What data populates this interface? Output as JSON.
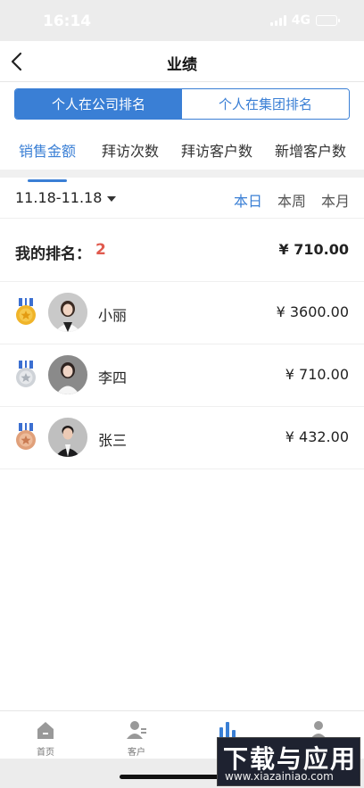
{
  "status_bar": {
    "time": "16:14",
    "network": "4G"
  },
  "nav": {
    "title": "业绩"
  },
  "scope_tabs": [
    {
      "label": "个人在公司排名",
      "active": true
    },
    {
      "label": "个人在集团排名",
      "active": false
    }
  ],
  "metric_tabs": [
    {
      "label": "销售金额",
      "active": true
    },
    {
      "label": "拜访次数",
      "active": false
    },
    {
      "label": "拜访客户数",
      "active": false
    },
    {
      "label": "新增客户数",
      "active": false
    }
  ],
  "date_filter": {
    "range": "11.18-11.18"
  },
  "periods": [
    {
      "label": "本日",
      "active": true
    },
    {
      "label": "本周",
      "active": false
    },
    {
      "label": "本月",
      "active": false
    }
  ],
  "my_rank": {
    "label": "我的排名：",
    "value": "2",
    "amount": "¥ 710.00"
  },
  "ranking": [
    {
      "rank": 1,
      "medal": "gold-medal-icon",
      "name": "小丽",
      "amount": "¥ 3600.00"
    },
    {
      "rank": 2,
      "medal": "silver-medal-icon",
      "name": "李四",
      "amount": "¥ 710.00"
    },
    {
      "rank": 3,
      "medal": "bronze-medal-icon",
      "name": "张三",
      "amount": "¥ 432.00"
    }
  ],
  "tab_bar": [
    {
      "label": "首页",
      "icon": "home-icon"
    },
    {
      "label": "客户",
      "icon": "customer-icon"
    },
    {
      "label": "",
      "icon": "bar-chart-icon"
    },
    {
      "label": "",
      "icon": "profile-icon"
    }
  ],
  "watermark": {
    "big": "下载与应用",
    "small": "www.xiazainiao.com"
  },
  "colors": {
    "accent": "#3a7fd5",
    "rank_highlight": "#e05a4e",
    "gold": "#f0b429",
    "silver": "#cfd3d8",
    "bronze": "#e0a07a"
  }
}
